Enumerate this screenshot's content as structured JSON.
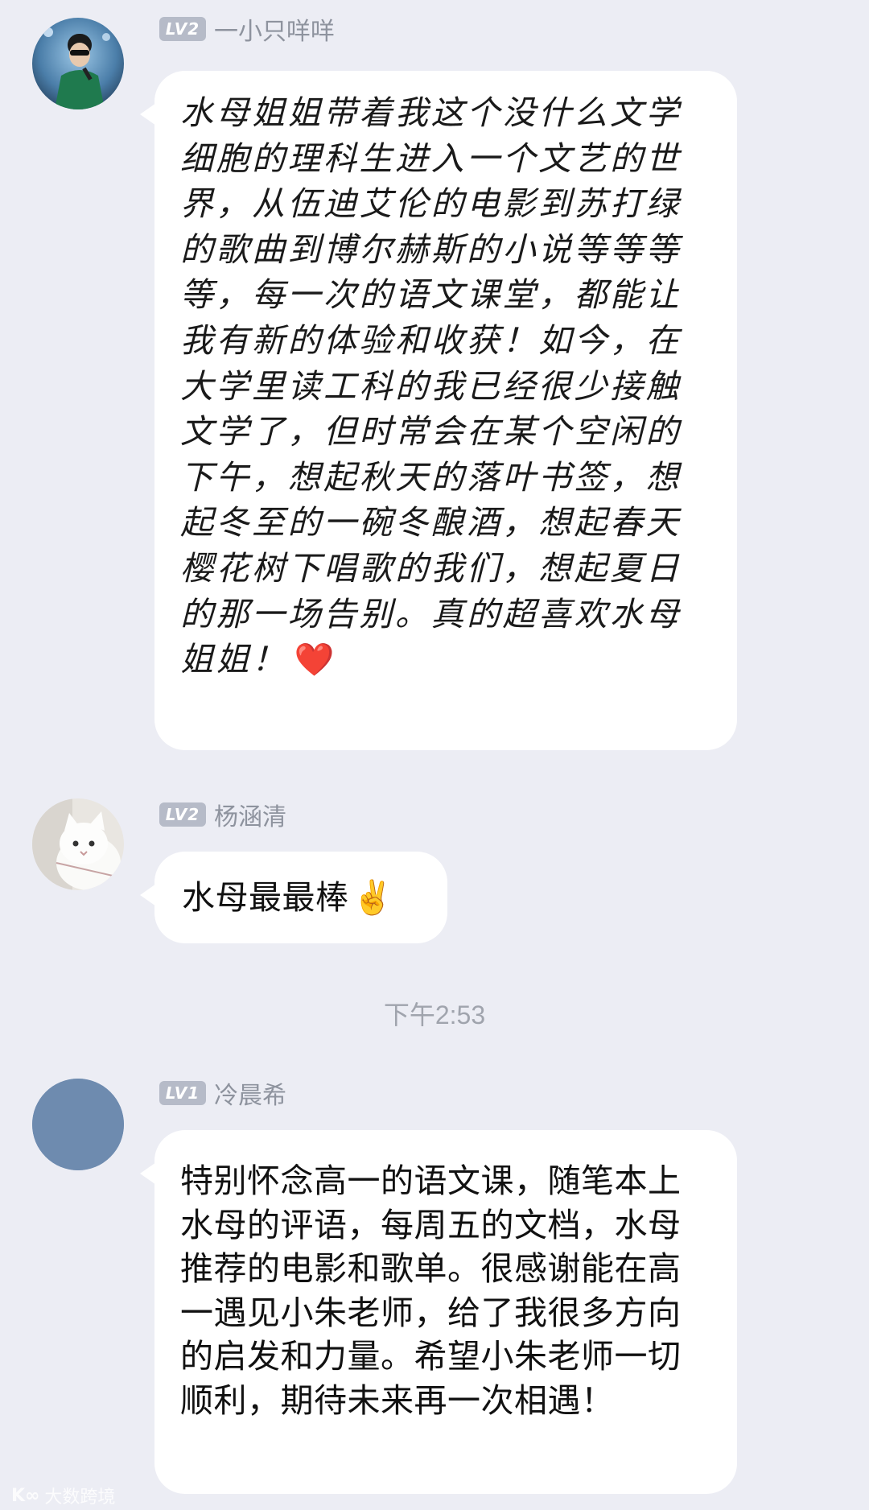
{
  "messages": [
    {
      "level": "LV2",
      "name": "一小只咩咩",
      "text": "水母姐姐带着我这个没什么文学细胞的理科生进入一个文艺的世界，从伍迪艾伦的电影到苏打绿的歌曲到博尔赫斯的小说等等等等，每一次的语文课堂，都能让我有新的体验和收获！如今，在大学里读工科的我已经很少接触文学了，但时常会在某个空闲的下午，想起秋天的落叶书签，想起冬至的一碗冬酿酒，想起春天樱花树下唱歌的我们，想起夏日的那一场告别。真的超喜欢水母姐姐！",
      "emoji": "❤️"
    },
    {
      "level": "LV2",
      "name": "杨涵清",
      "text": "水母最最棒",
      "emoji": "✌️"
    },
    {
      "level": "LV1",
      "name": "冷晨希",
      "text": "特别怀念高一的语文课，随笔本上水母的评语，每周五的文档，水母推荐的电影和歌单。很感谢能在高一遇见小朱老师，给了我很多方向的启发和力量。希望小朱老师一切顺利，期待未来再一次相遇！"
    }
  ],
  "timestamp": "下午2:53",
  "watermark": {
    "text": "大数跨境",
    "icon": "logo-icon"
  },
  "colors": {
    "background": "#ECEDF4",
    "bubble": "#FFFFFF",
    "badge": "#B6BBC8",
    "name": "#8E939E",
    "timestamp": "#A0A4AD",
    "avatar3": "#6E8BAF"
  }
}
